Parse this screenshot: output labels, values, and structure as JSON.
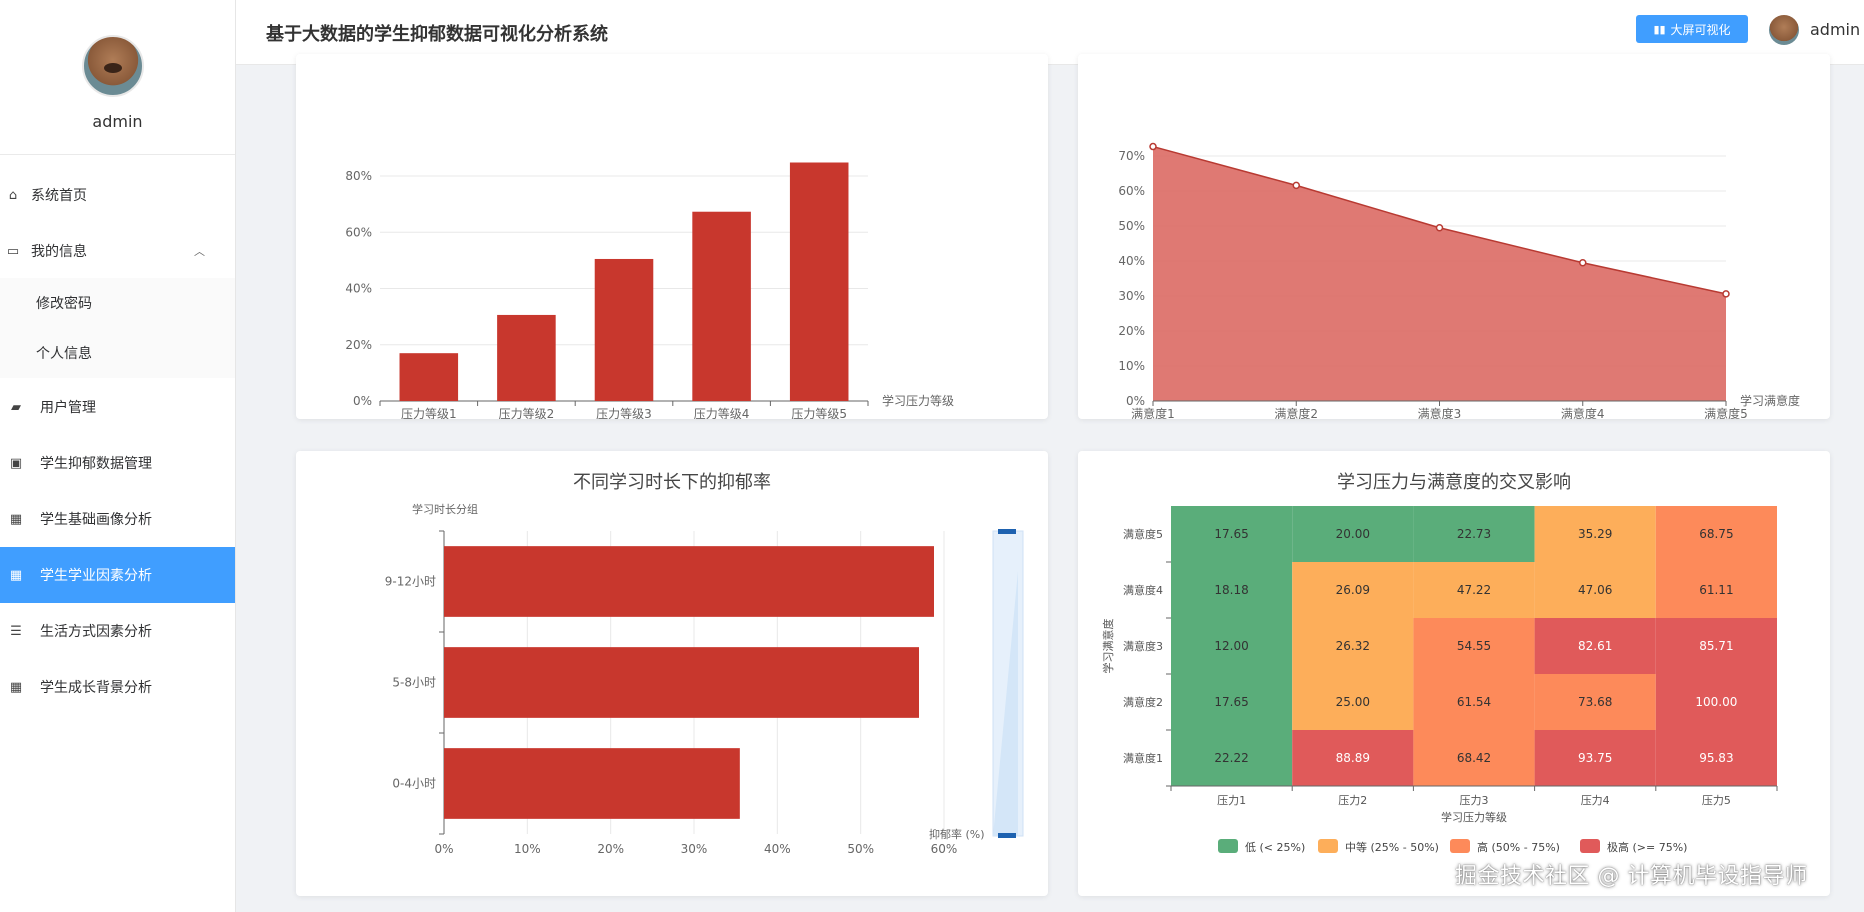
{
  "app": {
    "title": "基于大数据的学生抑郁数据可视化分析系统",
    "user": "admin",
    "big_screen_label": "大屏可视化"
  },
  "sidebar": {
    "username": "admin",
    "items": [
      {
        "label": "系统首页",
        "icon": "home-icon"
      },
      {
        "label": "我的信息",
        "icon": "card-icon"
      },
      {
        "label": "修改密码"
      },
      {
        "label": "个人信息"
      },
      {
        "label": "用户管理",
        "icon": "ticket-icon"
      },
      {
        "label": "学生抑郁数据管理",
        "icon": "clipboard-icon"
      },
      {
        "label": "学生基础画像分析",
        "icon": "grid-icon"
      },
      {
        "label": "学生学业因素分析",
        "icon": "grid-icon"
      },
      {
        "label": "生活方式因素分析",
        "icon": "sliders-icon"
      },
      {
        "label": "学生成长背景分析",
        "icon": "grid-icon"
      }
    ],
    "active": "学生学业因素分析"
  },
  "watermark": "掘金技术社区 @ 计算机毕设指导师",
  "colors": {
    "accent": "#409eff",
    "bar": "#c8372d",
    "area": "#d9625a"
  },
  "chart_data": [
    {
      "type": "bar",
      "categories": [
        "压力等级1",
        "压力等级2",
        "压力等级3",
        "压力等级4",
        "压力等级5"
      ],
      "values": [
        17,
        30.6,
        50.5,
        67.3,
        84.8
      ],
      "xlabel": "学习压力等级",
      "ylim": [
        0,
        80
      ],
      "yticks": [
        "0%",
        "20%",
        "40%",
        "60%",
        "80%"
      ]
    },
    {
      "type": "area",
      "categories": [
        "满意度1",
        "满意度2",
        "满意度3",
        "满意度4",
        "满意度5"
      ],
      "values": [
        72.7,
        61.6,
        49.5,
        39.5,
        30.6
      ],
      "xlabel": "学习满意度",
      "ylim": [
        0,
        70
      ],
      "yticks": [
        "0%",
        "10%",
        "20%",
        "30%",
        "40%",
        "50%",
        "60%",
        "70%"
      ]
    },
    {
      "type": "bar",
      "orientation": "horizontal",
      "title": "不同学习时长下的抑郁率",
      "categories": [
        "0-4小时",
        "5-8小时",
        "9-12小时"
      ],
      "values": [
        35.5,
        57,
        58.8
      ],
      "ylabel": "学习时长分组",
      "xlabel": "抑郁率 (%)",
      "xlim": [
        0,
        60
      ],
      "xticks": [
        "0%",
        "10%",
        "20%",
        "30%",
        "40%",
        "50%",
        "60%"
      ]
    },
    {
      "type": "heatmap",
      "title": "学习压力与满意度的交叉影响",
      "x": [
        "压力1",
        "压力2",
        "压力3",
        "压力4",
        "压力5"
      ],
      "y": [
        "满意度1",
        "满意度2",
        "满意度3",
        "满意度4",
        "满意度5"
      ],
      "values": [
        [
          "22.22",
          "88.89",
          "68.42",
          "93.75",
          "95.83"
        ],
        [
          "17.65",
          "25.00",
          "61.54",
          "73.68",
          "100.00"
        ],
        [
          "12.00",
          "26.32",
          "54.55",
          "82.61",
          "85.71"
        ],
        [
          "18.18",
          "26.09",
          "47.22",
          "47.06",
          "61.11"
        ],
        [
          "17.65",
          "20.00",
          "22.73",
          "35.29",
          "68.75"
        ]
      ],
      "xlabel": "学习压力等级",
      "ylabel": "学习满意度",
      "legend": [
        {
          "label": "低 (< 25%)",
          "color": "#5aad7a"
        },
        {
          "label": "中等 (25% - 50%)",
          "color": "#fdae5a"
        },
        {
          "label": "高 (50% - 75%)",
          "color": "#fd8a5a"
        },
        {
          "label": "极高 (>= 75%)",
          "color": "#e05a5a"
        }
      ],
      "legend_position": "bottom"
    }
  ]
}
